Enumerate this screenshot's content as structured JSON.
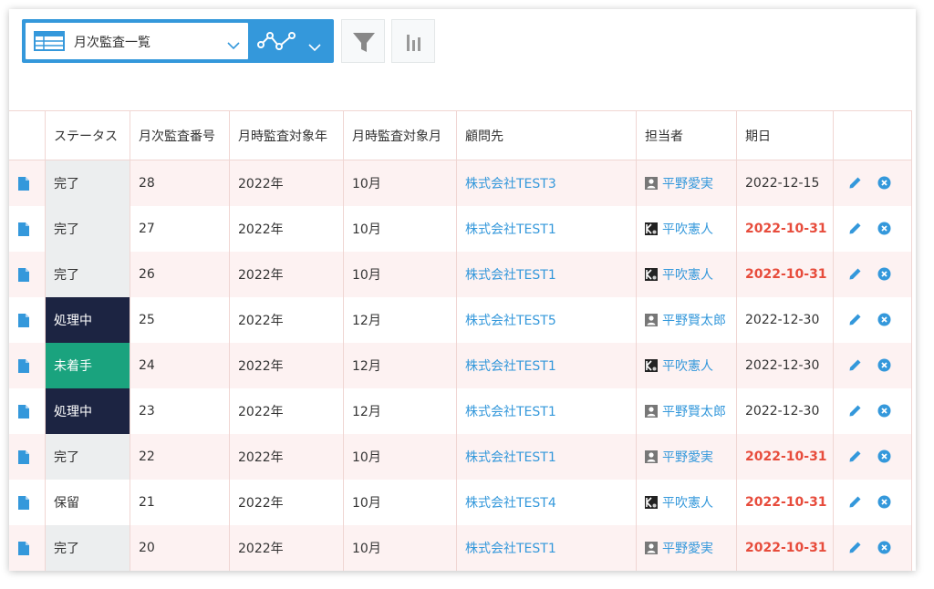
{
  "toolbar": {
    "view_name": "月次監査一覧",
    "icons": [
      "table-icon",
      "chevron-down-icon",
      "graph-icon",
      "filter-icon",
      "bar-chart-icon"
    ],
    "accent_color": "#3498db"
  },
  "table": {
    "headers": [
      "ステータス",
      "月次監査番号",
      "月時監査対象年",
      "月時監査対象月",
      "顧問先",
      "担当者",
      "期日"
    ],
    "rows": [
      {
        "status": "完了",
        "status_style": "gray",
        "number": "28",
        "year": "2022年",
        "month": "10月",
        "client": "株式会社TEST3",
        "assignee": "平野愛実",
        "avatar": "person",
        "due": "2022-12-15",
        "overdue": false
      },
      {
        "status": "完了",
        "status_style": "gray",
        "number": "27",
        "year": "2022年",
        "month": "10月",
        "client": "株式会社TEST1",
        "assignee": "平吹憲人",
        "avatar": "photo",
        "due": "2022-10-31",
        "overdue": true
      },
      {
        "status": "完了",
        "status_style": "gray",
        "number": "26",
        "year": "2022年",
        "month": "10月",
        "client": "株式会社TEST1",
        "assignee": "平吹憲人",
        "avatar": "photo",
        "due": "2022-10-31",
        "overdue": true
      },
      {
        "status": "処理中",
        "status_style": "navy",
        "number": "25",
        "year": "2022年",
        "month": "12月",
        "client": "株式会社TEST5",
        "assignee": "平野賢太郎",
        "avatar": "person",
        "due": "2022-12-30",
        "overdue": false
      },
      {
        "status": "未着手",
        "status_style": "green",
        "number": "24",
        "year": "2022年",
        "month": "12月",
        "client": "株式会社TEST1",
        "assignee": "平吹憲人",
        "avatar": "photo",
        "due": "2022-12-30",
        "overdue": false
      },
      {
        "status": "処理中",
        "status_style": "navy",
        "number": "23",
        "year": "2022年",
        "month": "12月",
        "client": "株式会社TEST1",
        "assignee": "平野賢太郎",
        "avatar": "person",
        "due": "2022-12-30",
        "overdue": false
      },
      {
        "status": "完了",
        "status_style": "gray",
        "number": "22",
        "year": "2022年",
        "month": "10月",
        "client": "株式会社TEST1",
        "assignee": "平野愛実",
        "avatar": "person",
        "due": "2022-10-31",
        "overdue": true
      },
      {
        "status": "保留",
        "status_style": "none",
        "number": "21",
        "year": "2022年",
        "month": "10月",
        "client": "株式会社TEST4",
        "assignee": "平吹憲人",
        "avatar": "photo",
        "due": "2022-10-31",
        "overdue": true
      },
      {
        "status": "完了",
        "status_style": "gray",
        "number": "20",
        "year": "2022年",
        "month": "10月",
        "client": "株式会社TEST1",
        "assignee": "平野愛実",
        "avatar": "person",
        "due": "2022-10-31",
        "overdue": true
      }
    ]
  },
  "colors": {
    "link": "#3498db",
    "overdue": "#e74c3c",
    "status_navy": "#1c2442",
    "status_green": "#1aa37e",
    "status_gray": "#eceeef",
    "row_alt": "#fdf2f2"
  }
}
